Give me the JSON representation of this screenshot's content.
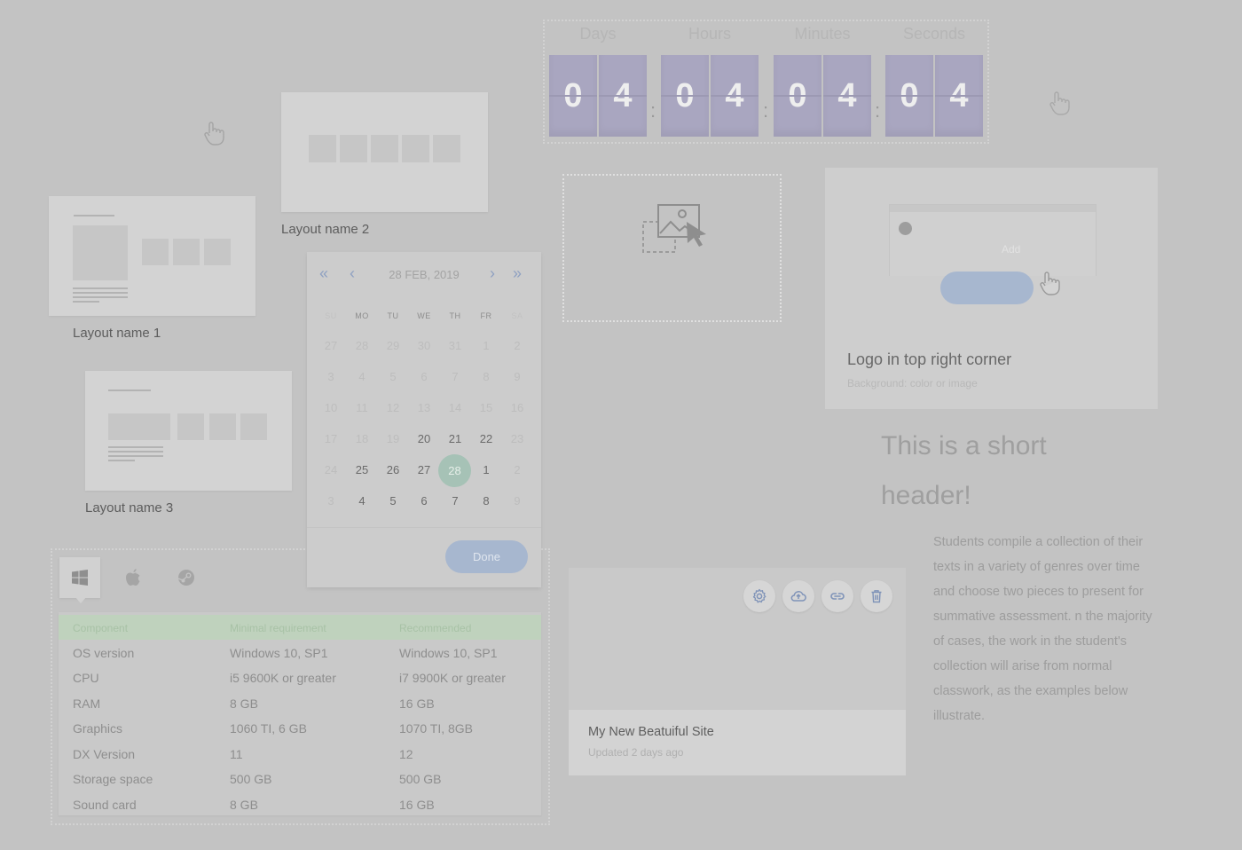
{
  "layouts": [
    {
      "name": "Layout name 1"
    },
    {
      "name": "Layout name 2"
    },
    {
      "name": "Layout name 3"
    }
  ],
  "countdown": {
    "labels": [
      "Days",
      "Hours",
      "Minutes",
      "Seconds"
    ],
    "digits": [
      "0",
      "4",
      "0",
      "4",
      "0",
      "4",
      "0",
      "4"
    ],
    "separator": ":"
  },
  "calendar": {
    "title": "28 FEB, 2019",
    "weekdays": [
      "SU",
      "MO",
      "TU",
      "WE",
      "TH",
      "FR",
      "SA"
    ],
    "weeks": [
      [
        "27",
        "28",
        "29",
        "30",
        "31",
        "1",
        "2"
      ],
      [
        "3",
        "4",
        "5",
        "6",
        "7",
        "8",
        "9"
      ],
      [
        "10",
        "11",
        "12",
        "13",
        "14",
        "15",
        "16"
      ],
      [
        "17",
        "18",
        "19",
        "20",
        "21",
        "22",
        "23"
      ],
      [
        "24",
        "25",
        "26",
        "27",
        "28",
        "1",
        "2"
      ],
      [
        "3",
        "4",
        "5",
        "6",
        "7",
        "8",
        "9"
      ]
    ],
    "selected": "28",
    "done_label": "Done"
  },
  "logo_card": {
    "add_label": "Add",
    "title": "Logo in top right corner",
    "subtitle": "Background: color or image"
  },
  "specs": {
    "platform_tabs": [
      "windows-icon",
      "apple-icon",
      "steam-icon"
    ],
    "header": [
      "Component",
      "Minimal requirement",
      "Recommended"
    ],
    "rows": [
      [
        "OS version",
        "Windows 10, SP1",
        "Windows 10, SP1"
      ],
      [
        "CPU",
        "i5 9600K or greater",
        "i7 9900K or greater"
      ],
      [
        "RAM",
        "8 GB",
        "16 GB"
      ],
      [
        "Graphics",
        "1060 TI, 6 GB",
        "1070 TI, 8GB"
      ],
      [
        "DX Version",
        "11",
        "12"
      ],
      [
        "Storage space",
        "500 GB",
        "500 GB"
      ],
      [
        "Sound card",
        "8 GB",
        "16 GB"
      ]
    ]
  },
  "site_card": {
    "title": "My New Beatuiful Site",
    "updated": "Updated 2 days ago",
    "actions": [
      "gear-icon",
      "cloud-upload-icon",
      "link-icon",
      "trash-icon"
    ]
  },
  "article": {
    "header": "This is a short header!",
    "body": "Students compile a collection of their texts in a variety of genres over time and choose two pieces to present for summative assessment. n the majority of cases, the work in the student's collection will arise from normal classwork, as the examples below illustrate."
  },
  "colors": {
    "background": "#c3c3c3",
    "digit_tile": "#a9a6c0",
    "accent_button": "#a7b7cf",
    "selected_day": "#a6c2b6",
    "table_header": "#bfd2bd"
  }
}
